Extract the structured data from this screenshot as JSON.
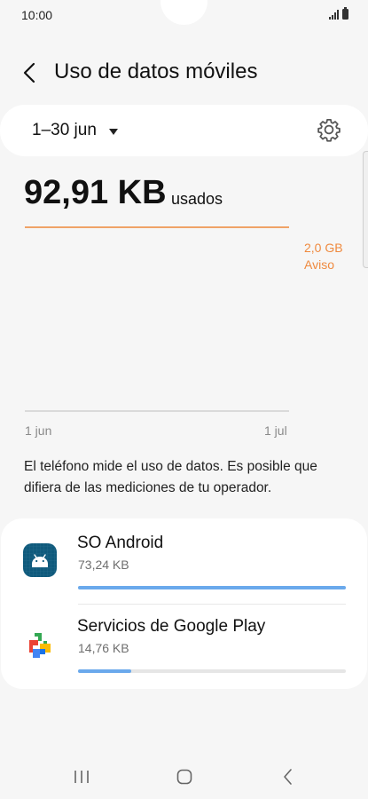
{
  "status_bar": {
    "time": "10:00",
    "icons": [
      "signal-icon",
      "battery-icon"
    ]
  },
  "header": {
    "title": "Uso de datos móviles",
    "back_icon": "chevron-left-icon"
  },
  "period": {
    "label": "1–30 jun",
    "dropdown_icon": "caret-down-icon",
    "settings_icon": "gear-icon"
  },
  "usage": {
    "value": "92,91 KB",
    "suffix": "usados"
  },
  "chart": {
    "warning_amount": "2,0 GB",
    "warning_label": "Aviso",
    "axis_start": "1 jun",
    "axis_end": "1 jul",
    "line_color": "#f0a367"
  },
  "disclaimer": "El teléfono mide el uso de datos. Es posible que difiera de las mediciones de tu operador.",
  "apps": [
    {
      "name": "SO Android",
      "size": "73,24 KB",
      "usage_fraction": 1.0,
      "icon": "android-icon"
    },
    {
      "name": "Servicios de Google Play",
      "size": "14,76 KB",
      "usage_fraction": 0.2,
      "icon": "google-play-services-icon"
    }
  ],
  "colors": {
    "accent_bar": "#6aa9ec",
    "warning": "#ef8a3f"
  },
  "nav": {
    "icons": [
      "recent-apps-icon",
      "home-icon",
      "back-icon"
    ]
  }
}
